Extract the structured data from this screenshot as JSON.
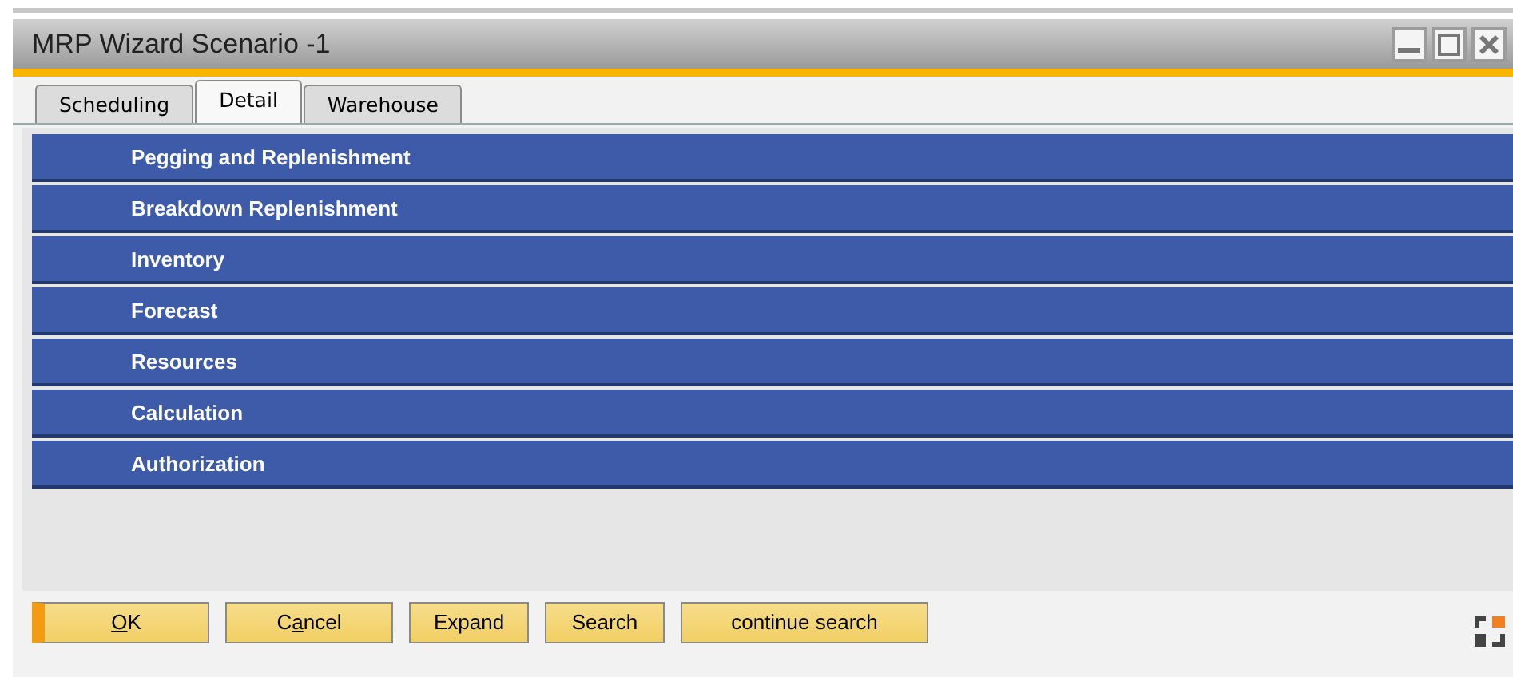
{
  "window": {
    "title": "MRP Wizard Scenario -1"
  },
  "tabs": [
    {
      "label": "Scheduling",
      "selected": false
    },
    {
      "label": "Detail",
      "selected": true
    },
    {
      "label": "Warehouse",
      "selected": false
    }
  ],
  "sections": [
    {
      "label": "Pegging and Replenishment"
    },
    {
      "label": "Breakdown Replenishment"
    },
    {
      "label": "Inventory"
    },
    {
      "label": "Forecast"
    },
    {
      "label": "Resources"
    },
    {
      "label": "Calculation"
    },
    {
      "label": "Authorization"
    }
  ],
  "buttons": [
    {
      "key": "O",
      "post": "K",
      "default": true
    },
    {
      "pre": "C",
      "key": "a",
      "post": "ncel",
      "default": false
    },
    {
      "pre": "Expand",
      "default": false
    },
    {
      "pre": "Search",
      "default": false
    },
    {
      "pre": "continue search",
      "default": false
    }
  ]
}
